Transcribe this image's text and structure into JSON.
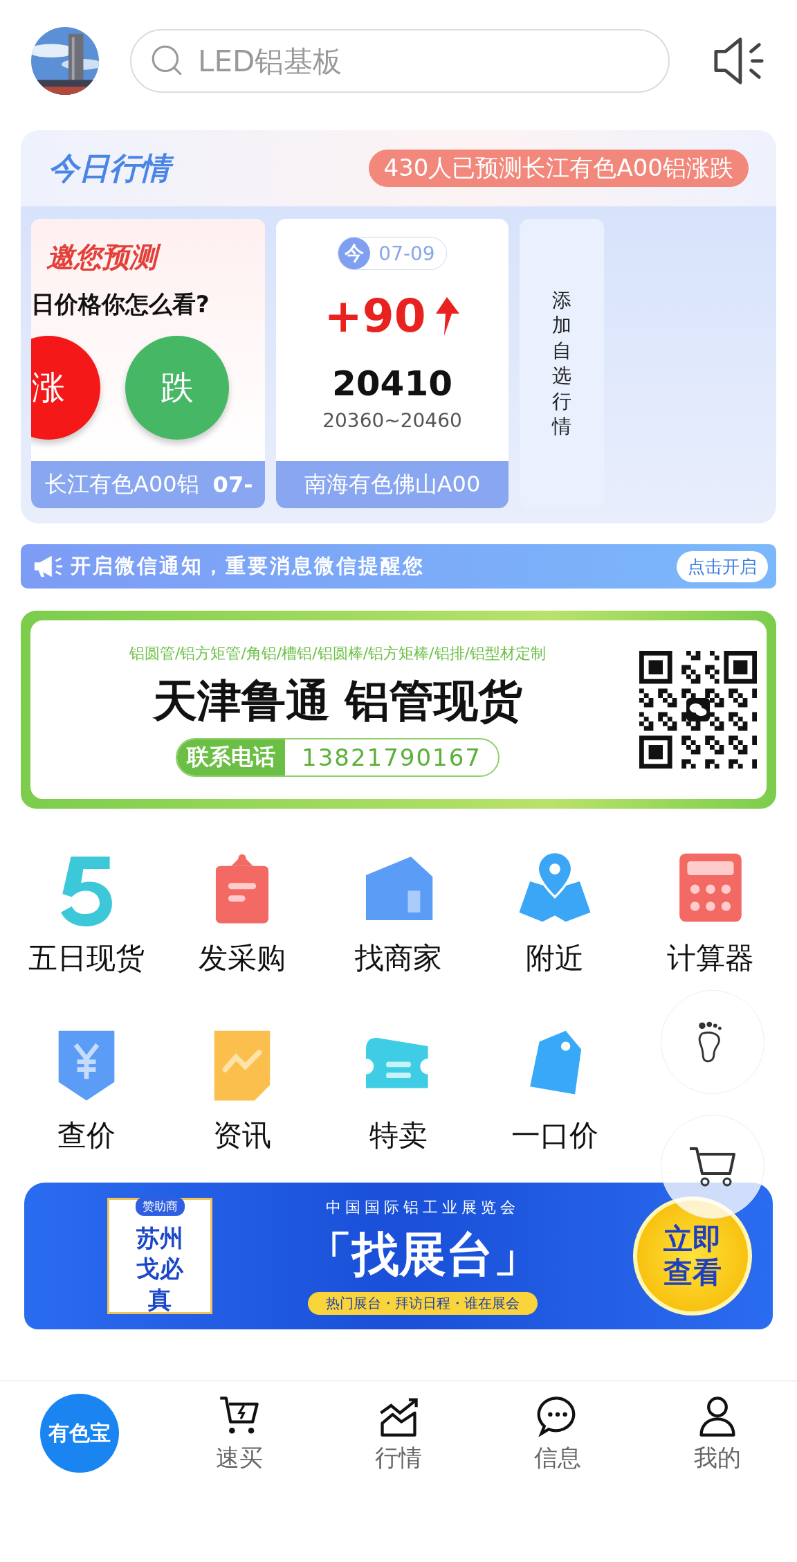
{
  "search": {
    "placeholder": "LED铝基板"
  },
  "market": {
    "title": "今日行情",
    "banner": "430人已预测长江有色A00铝涨跌",
    "predict": {
      "title": "邀您预测",
      "question": "日价格你怎么看?",
      "up": "涨",
      "down": "跌",
      "name": "长江有色A00铝",
      "date": "07-"
    },
    "quote": {
      "badge": "今",
      "date": "07-09",
      "change": "+90",
      "price": "20410",
      "range": "20360~20460",
      "name": "南海有色佛山A00"
    },
    "add": "添加自选行情"
  },
  "notice": {
    "text": "开启微信通知，重要消息微信提醒您",
    "button": "点击开启"
  },
  "ad": {
    "products": "铝圆管/铝方矩管/角铝/槽铝/铝圆棒/铝方矩棒/铝排/铝型材定制",
    "headline": "天津鲁通 铝管现货",
    "phone_label": "联系电话",
    "phone": "13821790167"
  },
  "grid": [
    {
      "label": "五日现货",
      "kind": "five"
    },
    {
      "label": "发采购",
      "kind": "clipboard"
    },
    {
      "label": "找商家",
      "kind": "house"
    },
    {
      "label": "附近",
      "kind": "pin"
    },
    {
      "label": "计算器",
      "kind": "calculator"
    },
    {
      "label": "查价",
      "kind": "yen"
    },
    {
      "label": "资讯",
      "kind": "news"
    },
    {
      "label": "特卖",
      "kind": "ticket"
    },
    {
      "label": "一口价",
      "kind": "tag"
    }
  ],
  "expo": {
    "sponsor": "赞助商",
    "company": "苏州戈必真",
    "title": "中国国际铝工业展览会",
    "headline": "「找展台」",
    "links": "热门展台・拜访日程・谁在展会",
    "button": "立即查看"
  },
  "tabs": [
    {
      "label": "有色宝",
      "kind": "logo",
      "selected": true
    },
    {
      "label": "速买",
      "kind": "cart",
      "selected": false
    },
    {
      "label": "行情",
      "kind": "chart",
      "selected": false
    },
    {
      "label": "信息",
      "kind": "chat",
      "selected": false
    },
    {
      "label": "我的",
      "kind": "user",
      "selected": false
    }
  ]
}
